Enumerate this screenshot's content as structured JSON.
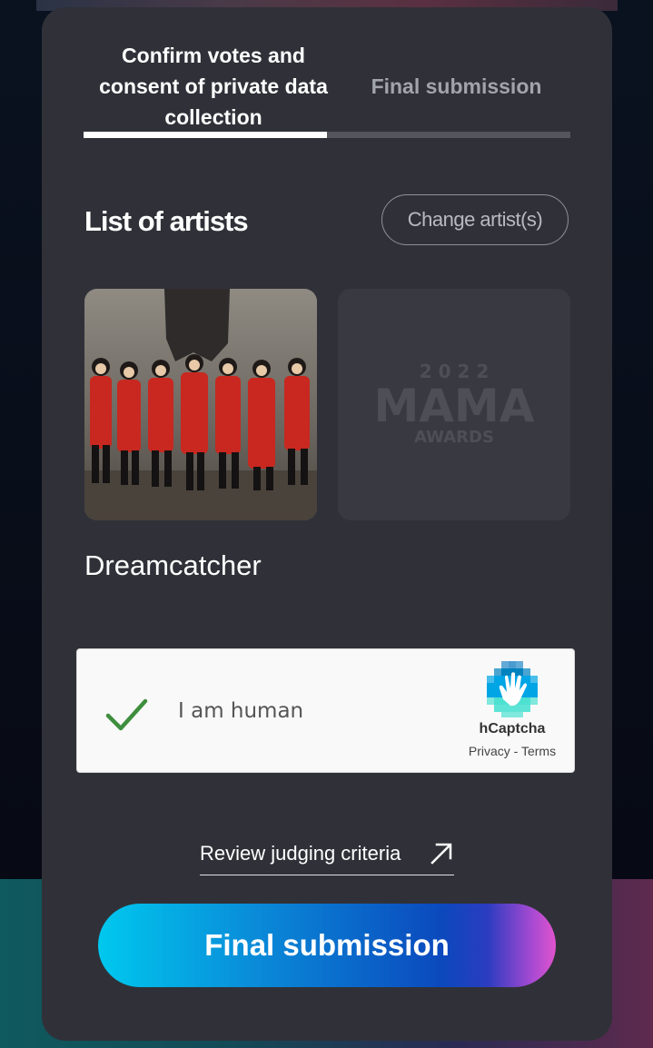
{
  "tabs": {
    "confirm_label": "Confirm votes and consent of private data collection",
    "final_label": "Final submission"
  },
  "progress": {
    "active_step": 1,
    "total_steps": 2
  },
  "artists_section": {
    "title": "List of artists",
    "change_button": "Change artist(s)",
    "artists": [
      {
        "name": "Dreamcatcher"
      }
    ],
    "placeholder_logo": {
      "year": "2 0 2 2",
      "wordmark": "MAMA",
      "subtitle": "AWARDS"
    }
  },
  "captcha": {
    "text": "I am human",
    "brand": "hCaptcha",
    "links": "Privacy - Terms",
    "checked": true,
    "check_color": "#3e8e3e"
  },
  "review_link": {
    "label": "Review judging criteria",
    "icon": "external-arrow-icon"
  },
  "submit": {
    "label": "Final submission"
  },
  "colors": {
    "modal_bg": "#303138",
    "accent_from": "#00c8ee",
    "accent_to": "#e054cd"
  }
}
